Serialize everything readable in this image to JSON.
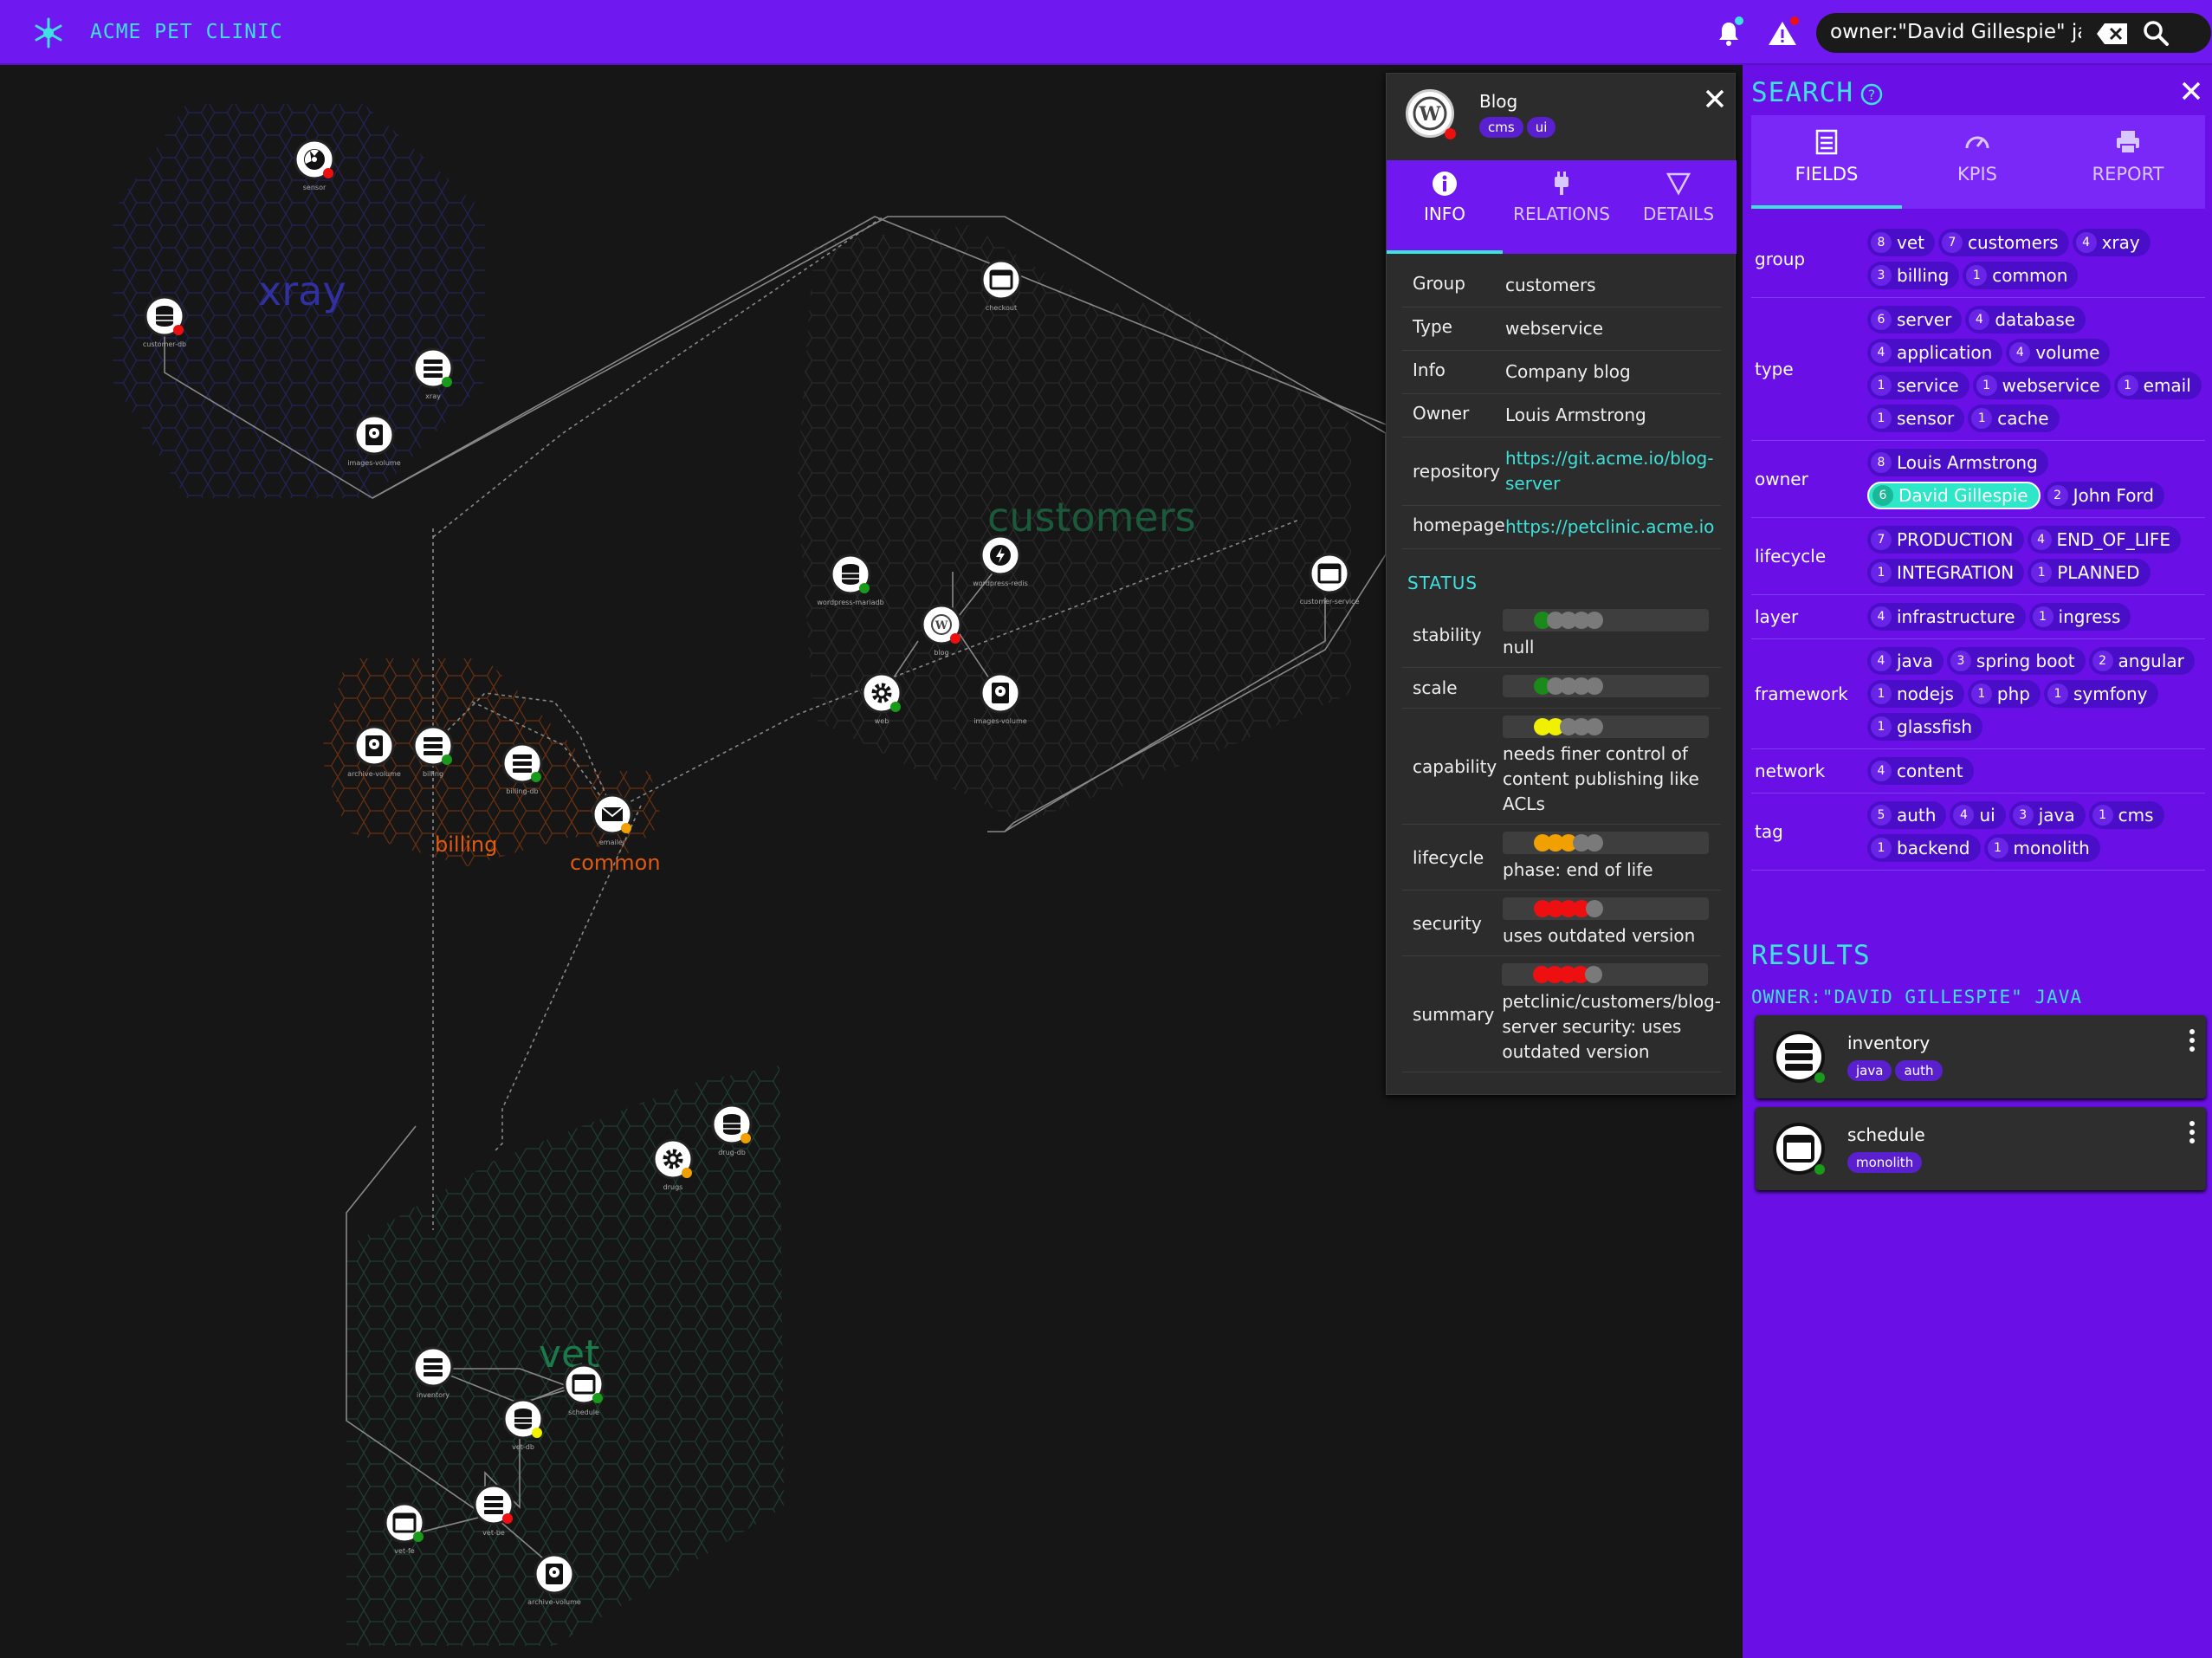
{
  "app": {
    "title": "ACME PET CLINIC"
  },
  "search": {
    "query": "owner:\"David Gillespie\" jav"
  },
  "graph": {
    "groups": [
      {
        "name": "xray",
        "color": "#3030a0"
      },
      {
        "name": "customers",
        "color": "#1a5a3a"
      },
      {
        "name": "billing",
        "color": "#e05a10"
      },
      {
        "name": "common",
        "color": "#e05a10"
      },
      {
        "name": "vet",
        "color": "#1a7a4a"
      }
    ],
    "nodes": [
      {
        "label": "sensor",
        "icon": "radiation-icon",
        "status": "red"
      },
      {
        "label": "customer-db",
        "icon": "database-icon",
        "status": "red"
      },
      {
        "label": "xray",
        "icon": "server-icon",
        "status": "green"
      },
      {
        "label": "images-volume",
        "icon": "disk-icon",
        "status": "none"
      },
      {
        "label": "checkout",
        "icon": "window-icon",
        "status": "none"
      },
      {
        "label": "wordpress-mariadb",
        "icon": "database-icon",
        "status": "green"
      },
      {
        "label": "wordpress-redis",
        "icon": "bolt-icon",
        "status": "none"
      },
      {
        "label": "blog",
        "icon": "wordpress-icon",
        "status": "red"
      },
      {
        "label": "customer-service",
        "icon": "window-icon",
        "status": "none"
      },
      {
        "label": "web",
        "icon": "gear-icon",
        "status": "green"
      },
      {
        "label": "images-volume",
        "icon": "disk-icon",
        "status": "none"
      },
      {
        "label": "archive-volume",
        "icon": "disk-icon",
        "status": "none"
      },
      {
        "label": "billing",
        "icon": "server-icon",
        "status": "green"
      },
      {
        "label": "billing-db",
        "icon": "server-icon",
        "status": "green"
      },
      {
        "label": "emailer",
        "icon": "mail-icon",
        "status": "orange"
      },
      {
        "label": "drugs",
        "icon": "gear-icon",
        "status": "orange"
      },
      {
        "label": "drug-db",
        "icon": "database-icon",
        "status": "orange"
      },
      {
        "label": "inventory",
        "icon": "server-icon",
        "status": "none"
      },
      {
        "label": "schedule",
        "icon": "window-icon",
        "status": "green"
      },
      {
        "label": "vet-db",
        "icon": "database-icon",
        "status": "yellow"
      },
      {
        "label": "vet-be",
        "icon": "server-icon",
        "status": "red"
      },
      {
        "label": "vet-fe",
        "icon": "window-icon",
        "status": "green"
      },
      {
        "label": "archive-volume",
        "icon": "disk-icon",
        "status": "none"
      }
    ]
  },
  "detail": {
    "name": "Blog",
    "tags": [
      "cms",
      "ui"
    ],
    "tabs": [
      {
        "label": "INFO",
        "icon": "info-icon"
      },
      {
        "label": "RELATIONS",
        "icon": "plug-icon"
      },
      {
        "label": "DETAILS",
        "icon": "filter-icon"
      }
    ],
    "fields": [
      {
        "key": "Group",
        "value": "customers"
      },
      {
        "key": "Type",
        "value": "webservice"
      },
      {
        "key": "Info",
        "value": "Company blog"
      },
      {
        "key": "Owner",
        "value": "Louis Armstrong"
      },
      {
        "key": "repository",
        "value": "https://git.acme.io/blog-server"
      },
      {
        "key": "homepage",
        "value": "https://petclinic.acme.io"
      }
    ],
    "status_title": "STATUS",
    "status": [
      {
        "key": "stability",
        "level": 1,
        "color": "#1a8a1a",
        "text": "null"
      },
      {
        "key": "scale",
        "level": 1,
        "color": "#1a8a1a",
        "text": ""
      },
      {
        "key": "capability",
        "level": 2,
        "color": "#f0f000",
        "text": "needs finer control of content publishing like ACLs"
      },
      {
        "key": "lifecycle",
        "level": 3,
        "color": "#f0a000",
        "text": "phase: end of life"
      },
      {
        "key": "security",
        "level": 4,
        "color": "#ee1010",
        "text": "uses outdated version"
      },
      {
        "key": "summary",
        "level": 4,
        "color": "#ee1010",
        "text": "petclinic/customers/blog-server security: uses outdated version"
      }
    ]
  },
  "search_panel": {
    "title": "SEARCH",
    "tabs": [
      {
        "label": "FIELDS",
        "icon": "list-icon"
      },
      {
        "label": "KPIS",
        "icon": "gauge-icon"
      },
      {
        "label": "REPORT",
        "icon": "print-icon"
      }
    ],
    "facets": [
      {
        "name": "group",
        "values": [
          {
            "n": "8",
            "v": "vet"
          },
          {
            "n": "7",
            "v": "customers"
          },
          {
            "n": "4",
            "v": "xray"
          },
          {
            "n": "3",
            "v": "billing"
          },
          {
            "n": "1",
            "v": "common"
          }
        ]
      },
      {
        "name": "type",
        "values": [
          {
            "n": "6",
            "v": "server"
          },
          {
            "n": "4",
            "v": "database"
          },
          {
            "n": "4",
            "v": "application"
          },
          {
            "n": "4",
            "v": "volume"
          },
          {
            "n": "1",
            "v": "service"
          },
          {
            "n": "1",
            "v": "webservice"
          },
          {
            "n": "1",
            "v": "email"
          },
          {
            "n": "1",
            "v": "sensor"
          },
          {
            "n": "1",
            "v": "cache"
          }
        ]
      },
      {
        "name": "owner",
        "values": [
          {
            "n": "8",
            "v": "Louis Armstrong"
          },
          {
            "n": "6",
            "v": "David Gillespie",
            "selected": true
          },
          {
            "n": "2",
            "v": "John Ford"
          }
        ]
      },
      {
        "name": "lifecycle",
        "values": [
          {
            "n": "7",
            "v": "PRODUCTION"
          },
          {
            "n": "4",
            "v": "END_OF_LIFE"
          },
          {
            "n": "1",
            "v": "INTEGRATION"
          },
          {
            "n": "1",
            "v": "PLANNED"
          }
        ]
      },
      {
        "name": "layer",
        "values": [
          {
            "n": "4",
            "v": "infrastructure"
          },
          {
            "n": "1",
            "v": "ingress"
          }
        ]
      },
      {
        "name": "framework",
        "values": [
          {
            "n": "4",
            "v": "java"
          },
          {
            "n": "3",
            "v": "spring boot"
          },
          {
            "n": "2",
            "v": "angular"
          },
          {
            "n": "1",
            "v": "nodejs"
          },
          {
            "n": "1",
            "v": "php"
          },
          {
            "n": "1",
            "v": "symfony"
          },
          {
            "n": "1",
            "v": "glassfish"
          }
        ]
      },
      {
        "name": "network",
        "values": [
          {
            "n": "4",
            "v": "content"
          }
        ]
      },
      {
        "name": "tag",
        "values": [
          {
            "n": "5",
            "v": "auth"
          },
          {
            "n": "4",
            "v": "ui"
          },
          {
            "n": "3",
            "v": "java"
          },
          {
            "n": "1",
            "v": "cms"
          },
          {
            "n": "1",
            "v": "backend"
          },
          {
            "n": "1",
            "v": "monolith"
          }
        ]
      }
    ],
    "results_title": "RESULTS",
    "results_query": "OWNER:\"DAVID GILLESPIE\" JAVA",
    "results": [
      {
        "name": "inventory",
        "icon": "server-icon",
        "tags": [
          "java",
          "auth"
        ]
      },
      {
        "name": "schedule",
        "icon": "window-icon",
        "tags": [
          "monolith"
        ]
      }
    ]
  }
}
